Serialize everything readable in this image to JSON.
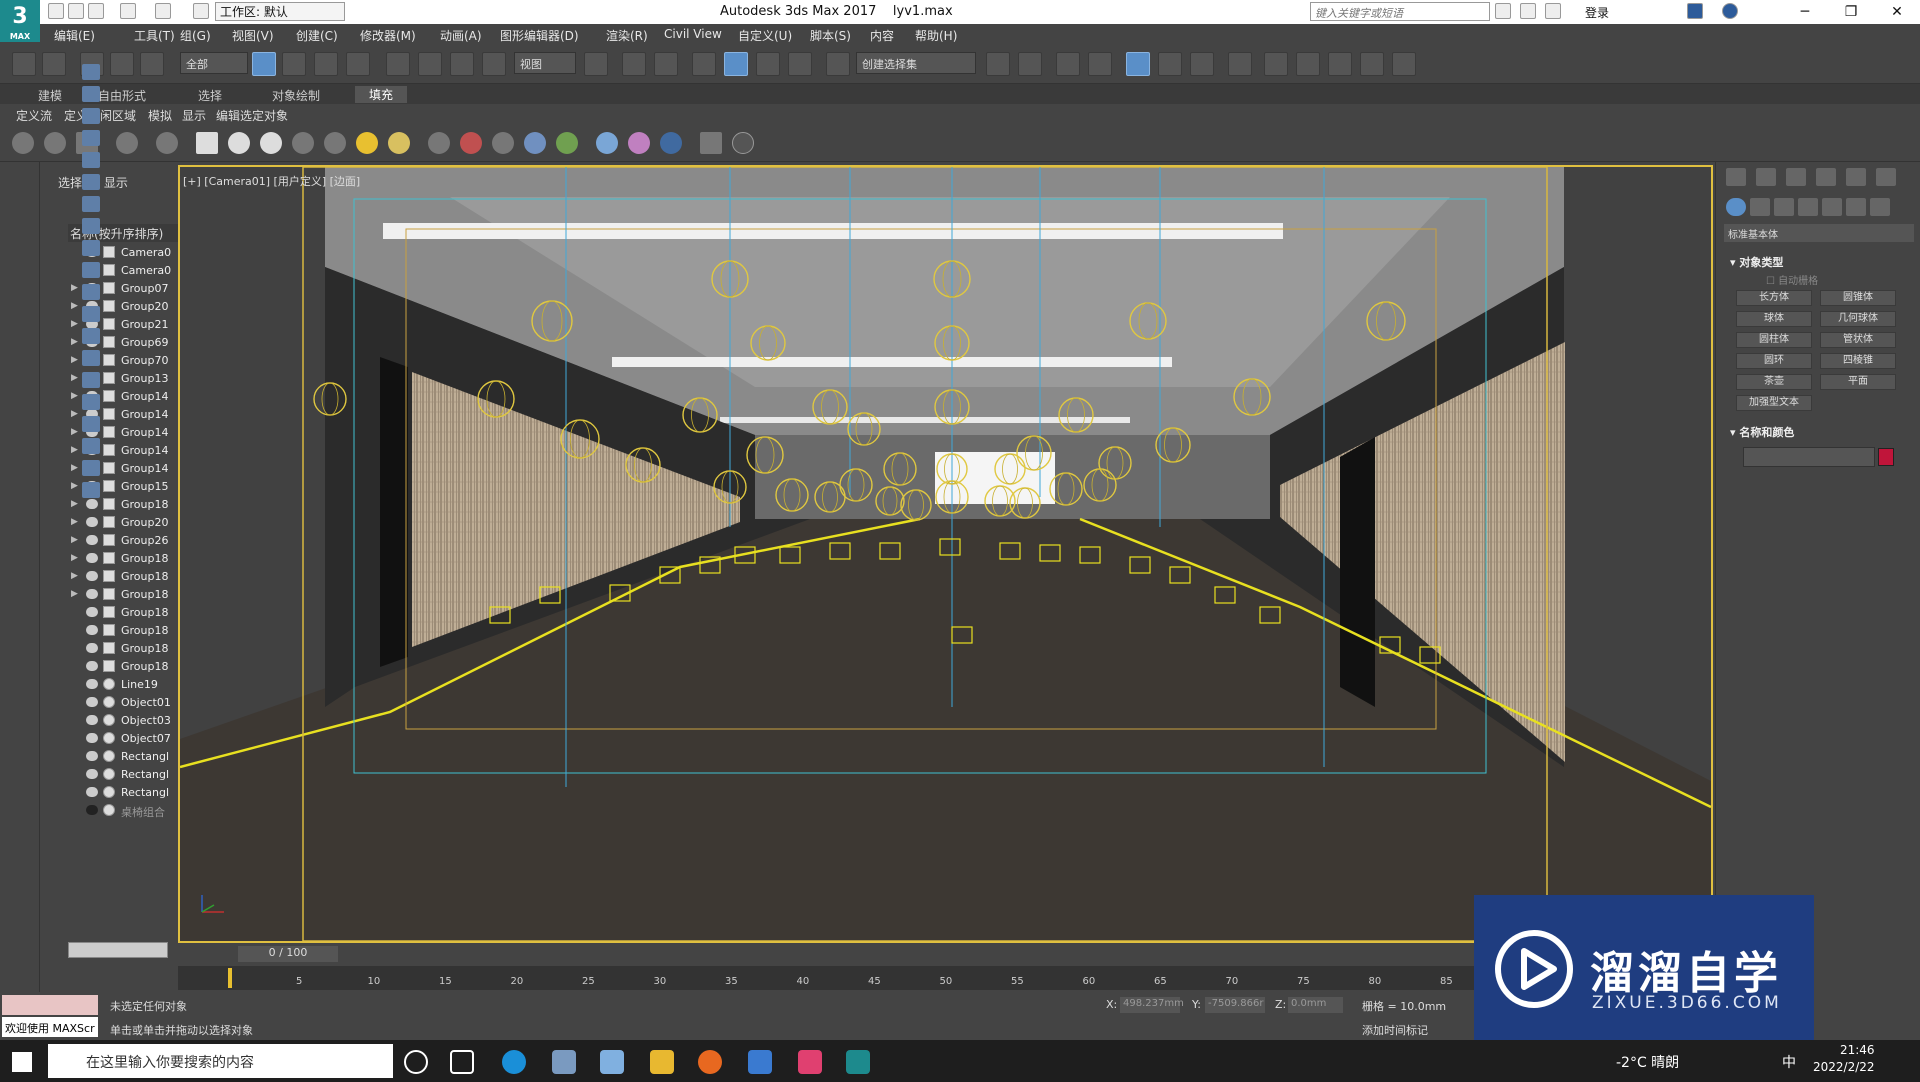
{
  "app": {
    "title": "Autodesk 3ds Max 2017",
    "file": "lyv1.max",
    "workspace": "工作区: 默认",
    "search_placeholder": "键入关键字或短语",
    "login": "登录",
    "logo": "3",
    "logo_sub": "MAX"
  },
  "menu": [
    "编辑(E)",
    "工具(T)",
    "组(G)",
    "视图(V)",
    "创建(C)",
    "修改器(M)",
    "动画(A)",
    "图形编辑器(D)",
    "渲染(R)",
    "Civil View",
    "自定义(U)",
    "脚本(S)",
    "内容",
    "帮助(H)"
  ],
  "toolbar": {
    "filter": "全部",
    "refcoord": "视图",
    "selection_set": "创建选择集"
  },
  "ribbon": {
    "tabs": [
      "建模",
      "自由形式",
      "选择",
      "对象绘制",
      "填充"
    ],
    "active": "填充",
    "subtabs": [
      "定义流",
      "定义空闲区域",
      "模拟",
      "显示",
      "编辑选定对象"
    ]
  },
  "explorer": {
    "tabs": [
      "选择",
      "显示"
    ],
    "header": "名称(按升序排序)",
    "items": [
      {
        "name": "Camera0",
        "expand": false,
        "type": "camera"
      },
      {
        "name": "Camera0",
        "expand": false,
        "type": "camera"
      },
      {
        "name": "Group07",
        "expand": true,
        "type": "group"
      },
      {
        "name": "Group20",
        "expand": true,
        "type": "group"
      },
      {
        "name": "Group21",
        "expand": true,
        "type": "group"
      },
      {
        "name": "Group69",
        "expand": true,
        "type": "group"
      },
      {
        "name": "Group70",
        "expand": true,
        "type": "group"
      },
      {
        "name": "Group13",
        "expand": true,
        "type": "group"
      },
      {
        "name": "Group14",
        "expand": true,
        "type": "group"
      },
      {
        "name": "Group14",
        "expand": true,
        "type": "group"
      },
      {
        "name": "Group14",
        "expand": true,
        "type": "group"
      },
      {
        "name": "Group14",
        "expand": true,
        "type": "group"
      },
      {
        "name": "Group14",
        "expand": true,
        "type": "group"
      },
      {
        "name": "Group15",
        "expand": true,
        "type": "group"
      },
      {
        "name": "Group18",
        "expand": true,
        "type": "group"
      },
      {
        "name": "Group20",
        "expand": true,
        "type": "group"
      },
      {
        "name": "Group26",
        "expand": true,
        "type": "group"
      },
      {
        "name": "Group18",
        "expand": true,
        "type": "group"
      },
      {
        "name": "Group18",
        "expand": true,
        "type": "group"
      },
      {
        "name": "Group18",
        "expand": true,
        "type": "group"
      },
      {
        "name": "Group18",
        "expand": false,
        "type": "group"
      },
      {
        "name": "Group18",
        "expand": false,
        "type": "group"
      },
      {
        "name": "Group18",
        "expand": false,
        "type": "group"
      },
      {
        "name": "Group18",
        "expand": false,
        "type": "group"
      },
      {
        "name": "Line19",
        "expand": false,
        "type": "shape"
      },
      {
        "name": "Object01",
        "expand": false,
        "type": "geo"
      },
      {
        "name": "Object03",
        "expand": false,
        "type": "geo"
      },
      {
        "name": "Object07",
        "expand": false,
        "type": "geo"
      },
      {
        "name": "Rectangl",
        "expand": false,
        "type": "shape"
      },
      {
        "name": "Rectangl",
        "expand": false,
        "type": "shape"
      },
      {
        "name": "Rectangl",
        "expand": false,
        "type": "shape"
      },
      {
        "name": "桌椅组合",
        "expand": false,
        "type": "hidden"
      }
    ]
  },
  "viewport": {
    "label": "[+] [Camera01] [用户定义] [边面]"
  },
  "command_panel": {
    "dropdown": "标准基本体",
    "object_type_header": "对象类型",
    "autogrid": "自动栅格",
    "buttons": [
      "长方体",
      "圆锥体",
      "球体",
      "几何球体",
      "圆柱体",
      "管状体",
      "圆环",
      "四棱锥",
      "茶壶",
      "平面",
      "加强型文本"
    ],
    "name_color_header": "名称和颜色",
    "object_color": "#c0153a"
  },
  "timeline": {
    "frame": "0 / 100",
    "ticks": [
      "5",
      "10",
      "15",
      "20",
      "25",
      "30",
      "35",
      "40",
      "45",
      "50",
      "55",
      "60",
      "65",
      "70",
      "75",
      "80",
      "85"
    ]
  },
  "status": {
    "welcome": "欢迎使用 MAXScr",
    "line1": "未选定任何对象",
    "line2": "单击或单击并拖动以选择对象",
    "x_label": "X:",
    "x": "498.237mm",
    "y_label": "Y:",
    "y": "-7509.866r",
    "z_label": "Z:",
    "z": "0.0mm",
    "grid": "栅格 = 10.0mm",
    "add_time_tag": "添加时间标记"
  },
  "watermark": {
    "brand": "溜溜自学",
    "url": "ZIXUE.3D66.COM"
  },
  "taskbar": {
    "search": "在这里输入你要搜索的内容",
    "weather": "-2°C  晴朗",
    "ime": "中",
    "time": "21:46",
    "date": "2022/2/22"
  },
  "colors": {
    "viewport_border": "#e0c040",
    "selection_blue": "#5a8fc8",
    "wire_yellow": "#e8d040",
    "safe_frame_cyan": "#40c0d0"
  }
}
